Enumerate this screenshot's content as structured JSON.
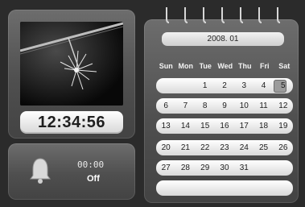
{
  "clock": {
    "time": "12:34:56"
  },
  "alarm": {
    "time": "00:00",
    "status": "Off",
    "icon": "bell-icon"
  },
  "calendar": {
    "month_label": "2008. 01",
    "weekdays": [
      "Sun",
      "Mon",
      "Tue",
      "Wed",
      "Thu",
      "Fri",
      "Sat"
    ],
    "weeks": [
      [
        "",
        "",
        "1",
        "2",
        "3",
        "4",
        "5"
      ],
      [
        "6",
        "7",
        "8",
        "9",
        "10",
        "11",
        "12"
      ],
      [
        "13",
        "14",
        "15",
        "16",
        "17",
        "18",
        "19"
      ],
      [
        "20",
        "21",
        "22",
        "23",
        "24",
        "25",
        "26"
      ],
      [
        "27",
        "28",
        "29",
        "30",
        "31",
        "",
        ""
      ],
      [
        "",
        "",
        "",
        "",
        "",
        "",
        ""
      ]
    ],
    "highlighted_day": "5"
  },
  "colors": {
    "background": "#2b2b2b",
    "panel": "#555555",
    "field": "#ffffff"
  }
}
